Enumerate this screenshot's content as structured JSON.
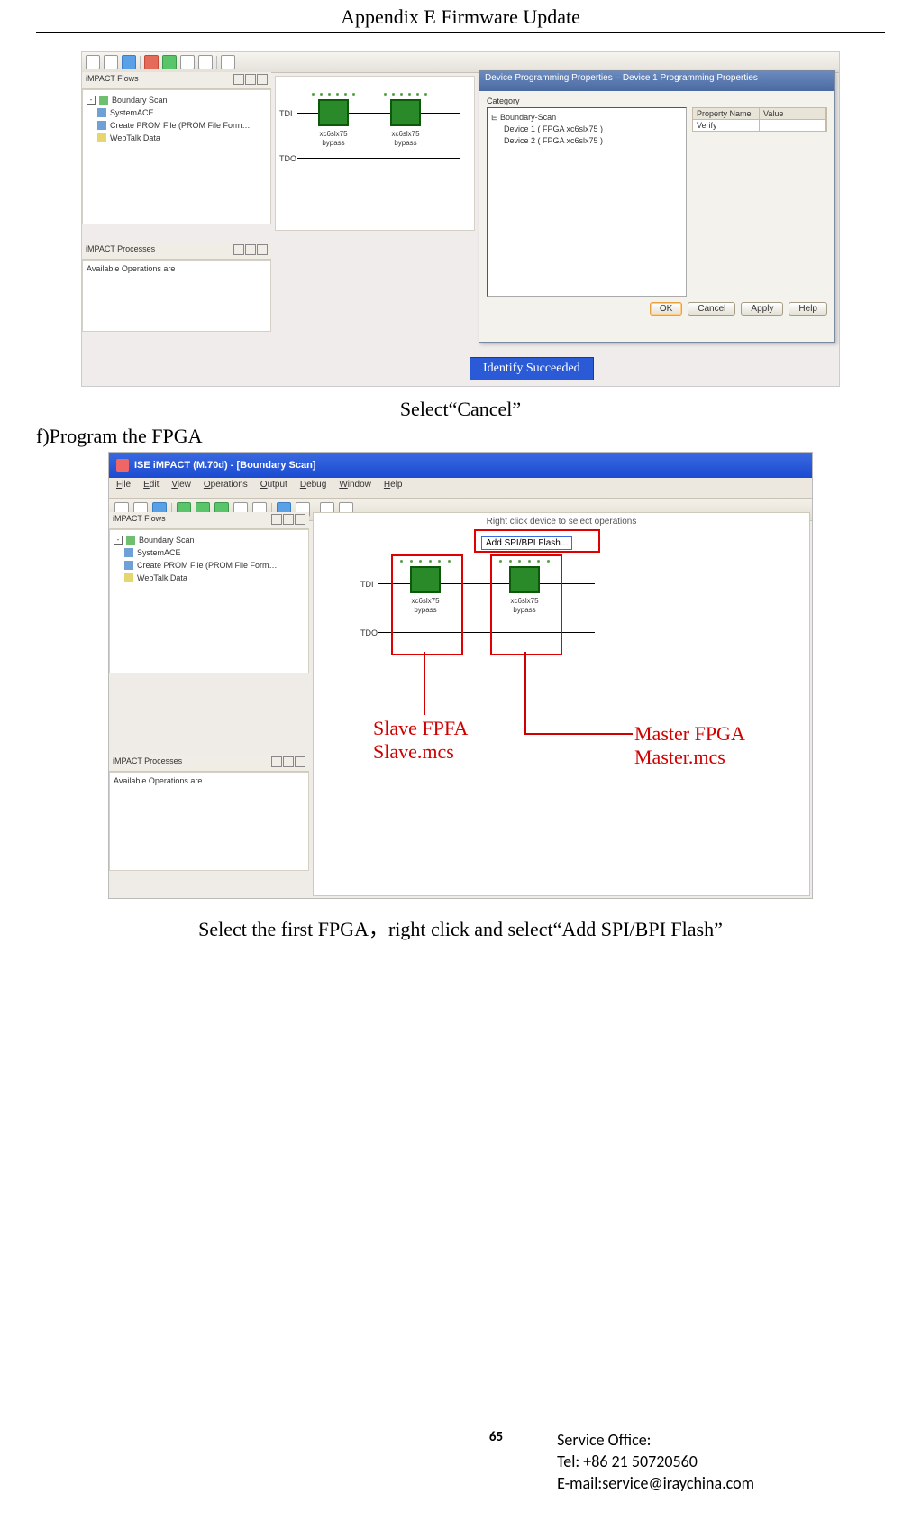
{
  "header": {
    "title": "Appendix E Firmware Update"
  },
  "shot1": {
    "panels": {
      "flows_title": "iMPACT Flows",
      "processes_title": "iMPACT Processes",
      "avail_ops": "Available Operations are"
    },
    "tree": {
      "boundary": "Boundary Scan",
      "sysace": "SystemACE",
      "create_prom": "Create PROM File (PROM File Form…",
      "webtalk": "WebTalk Data"
    },
    "chips": {
      "tdi": "TDI",
      "tdo": "TDO",
      "name": "xc6slx75",
      "mode": "bypass"
    },
    "dialog": {
      "title": "Device Programming Properties – Device 1 Programming Properties",
      "category": "Category",
      "bs": "Boundary-Scan",
      "dev1": "Device 1  ( FPGA xc6slx75 )",
      "dev2": "Device 2  ( FPGA xc6slx75 )",
      "prop_name": "Property Name",
      "prop_value": "Value",
      "verify": "Verify",
      "ok": "OK",
      "cancel": "Cancel",
      "apply": "Apply",
      "help": "Help"
    },
    "identify": "Identify Succeeded"
  },
  "caption1": "Select“Cancel”",
  "step_f": "f)Program the FPGA",
  "shot2": {
    "title": "ISE iMPACT (M.70d) - [Boundary Scan]",
    "menu": [
      "File",
      "Edit",
      "View",
      "Operations",
      "Output",
      "Debug",
      "Window",
      "Help"
    ],
    "panels": {
      "flows_title": "iMPACT Flows",
      "processes_title": "iMPACT Processes",
      "avail_ops": "Available Operations are"
    },
    "tree": {
      "boundary": "Boundary Scan",
      "sysace": "SystemACE",
      "create_prom": "Create PROM File (PROM File Form…",
      "webtalk": "WebTalk Data"
    },
    "canvas": {
      "hint": "Right click device to select operations",
      "addflash": "Add SPI/BPI Flash...",
      "tdi": "TDI",
      "tdo": "TDO",
      "chip_name": "xc6slx75",
      "chip_mode": "bypass"
    },
    "anno": {
      "slave1": "Slave FPFA",
      "slave2": "Slave.mcs",
      "master1": "Master FPGA",
      "master2": "Master.mcs"
    }
  },
  "caption2": "Select the first FPGA，right click and select“Add SPI/BPI Flash”",
  "footer": {
    "page": "65",
    "svc_office": "Service Office:",
    "tel": "Tel: +86 21 50720560",
    "email": "E-mail:service@iraychina.com"
  }
}
